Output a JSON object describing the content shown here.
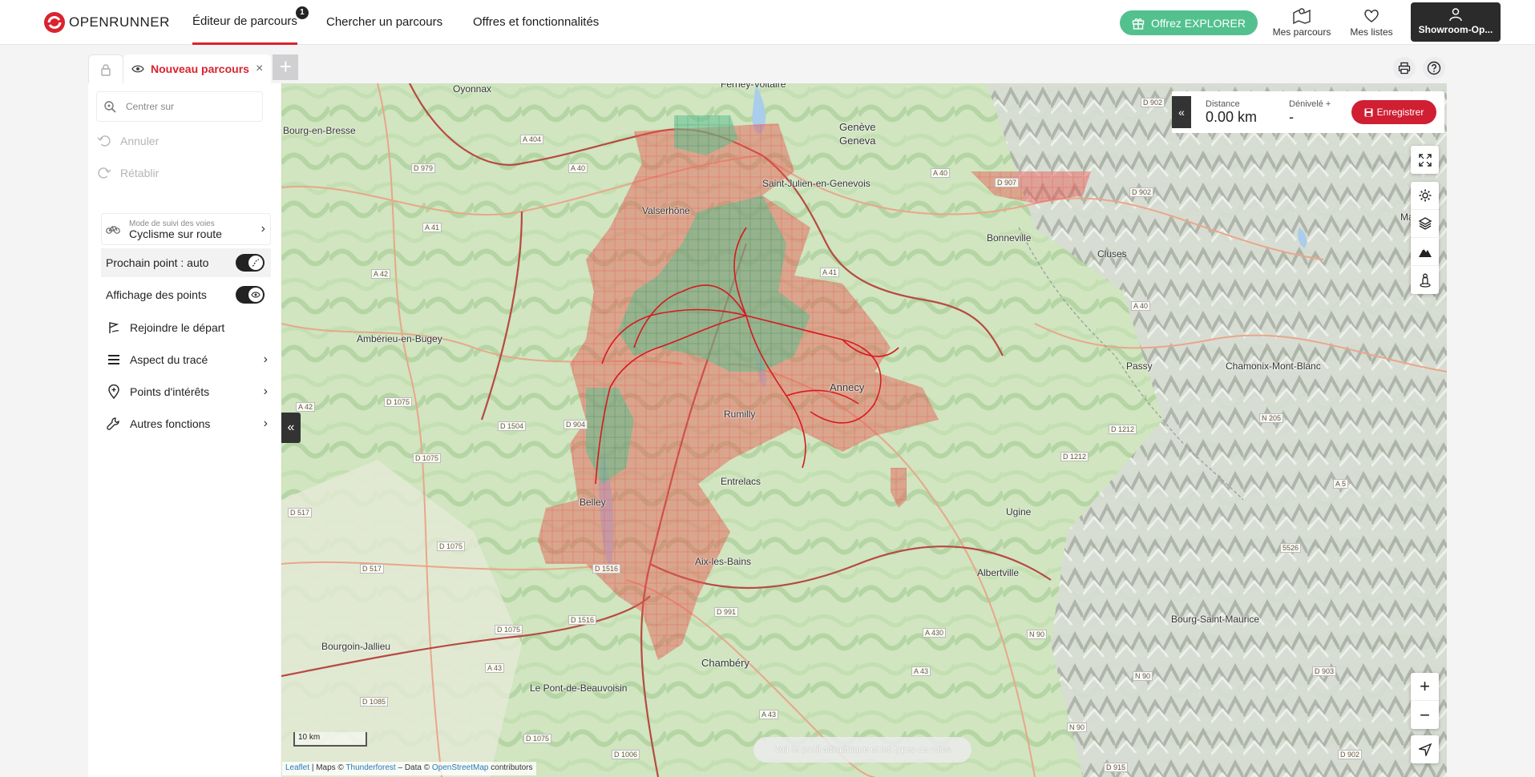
{
  "brand": {
    "name": "OPENRUNNER",
    "color": "#d9232e"
  },
  "nav": {
    "tabs": [
      {
        "label": "Éditeur de parcours",
        "badge": "1",
        "active": true
      },
      {
        "label": "Chercher un parcours"
      },
      {
        "label": "Offres et fonctionnalités"
      }
    ],
    "offer_label": "Offrez EXPLORER",
    "my_routes": "Mes parcours",
    "my_lists": "Mes listes",
    "account": "Showroom-Op..."
  },
  "editor_tab": {
    "title": "Nouveau parcours",
    "close": "×",
    "add": "+"
  },
  "sidebar": {
    "center_on": "Centrer sur",
    "undo": "Annuler",
    "redo": "Rétablir",
    "mode_caption": "Mode de suivi des voies",
    "mode_value": "Cyclisme sur route",
    "next_point": "Prochain point : auto",
    "show_points": "Affichage des points",
    "join_start": "Rejoindre le départ",
    "trace_look": "Aspect du tracé",
    "poi": "Points d'intérêts",
    "other": "Autres fonctions"
  },
  "stats": {
    "distance_label": "Distance",
    "distance_value": "0.00 km",
    "elevation_label": "Dénivelé +",
    "elevation_value": "-",
    "save_label": "Enregistrer"
  },
  "map": {
    "places": [
      "Oyonnax",
      "Ferney-Voltaire",
      "Genève",
      "Geneva",
      "Bourg-en-Bresse",
      "Saint-Julien-en-Genevois",
      "Valserhône",
      "Bonneville",
      "Cluses",
      "Martigny",
      "Ambérieu-en-Bugey",
      "Annecy",
      "Passy",
      "Chamonix-Mont-Blanc",
      "Rumilly",
      "Entrelacs",
      "Belley",
      "Ugine",
      "Aix-les-Bains",
      "Albertville",
      "Bourg-Saint-Maurice",
      "Bourgoin-Jallieu",
      "Chambéry",
      "Le Pont-de-Beauvoisin"
    ],
    "roads": [
      "D 902",
      "A 404",
      "D 979",
      "A 40",
      "A 40",
      "D 907",
      "D 902",
      "A 41",
      "A 42",
      "A 41",
      "A 40",
      "A 42",
      "D 1075",
      "D 1504",
      "D 904",
      "D 1075",
      "D 1212",
      "N 205",
      "D 1212",
      "A 5",
      "D 517",
      "D 1075",
      "D 1516",
      "D 517",
      "D 1516",
      "D 1075",
      "D 991",
      "A 430",
      "N 90",
      "5526",
      "A 43",
      "A 43",
      "N 90",
      "D 903",
      "D 1085",
      "D 1075",
      "A 43",
      "N 90",
      "D 902",
      "D 1006",
      "D 915"
    ],
    "scale": "10 km",
    "profile_hint": "Voir le profil altimétrique et les types de voies",
    "attribution": {
      "leaflet": "Leaflet",
      "maps": "Maps ©",
      "thunderforest": "Thunderforest",
      "data": "Data ©",
      "osm": "OpenStreetMap",
      "contributors": "contributors",
      "sep": "|"
    },
    "zoom_in": "+",
    "zoom_out": "−"
  },
  "colors": {
    "accent": "#d9232e",
    "offer": "#53c18e",
    "save": "#d01e33",
    "heat_red": "#e8574f",
    "heat_green": "#5fbf8d"
  }
}
